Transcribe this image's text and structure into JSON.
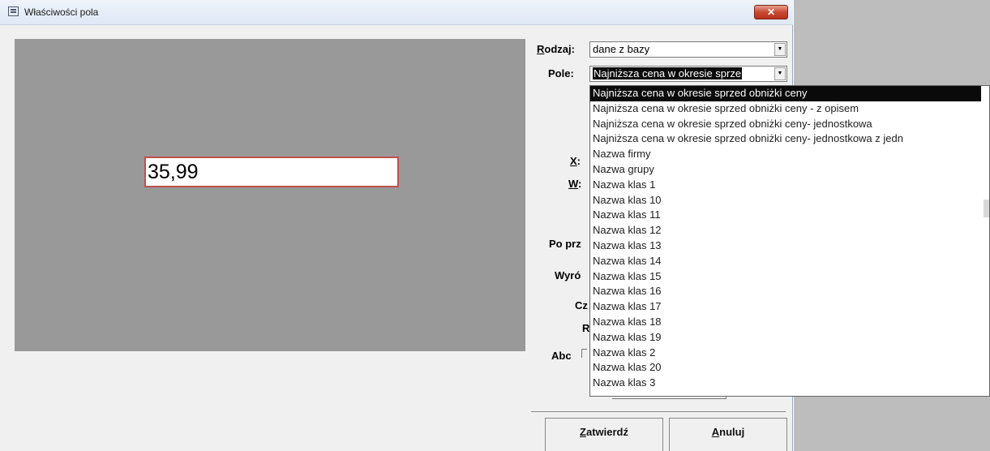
{
  "window": {
    "title": "Właściwości pola",
    "close_symbol": "✕"
  },
  "preview": {
    "value": "35,99"
  },
  "form": {
    "rodzaj": {
      "label_first": "R",
      "label_rest": "odzaj:",
      "value": "dane z bazy"
    },
    "pole": {
      "label": "Pole:",
      "value": "Najniższa cena w okresie sprze"
    },
    "x_label": {
      "first": "X",
      "rest": ":"
    },
    "w_label": {
      "first": "W",
      "rest": ":"
    },
    "partial_labels": [
      "Po prz",
      "Wyró",
      "Cz",
      "R",
      "Abc"
    ]
  },
  "dropdown": {
    "items": [
      "Najniższa cena w okresie sprzed obniżki ceny",
      "Najniższa cena w okresie sprzed obniżki ceny - z opisem",
      "Najniższa cena w okresie sprzed obniżki ceny- jednostkowa",
      "Najniższa cena w okresie sprzed obniżki ceny- jednostkowa z jedn",
      "Nazwa firmy",
      "Nazwa grupy",
      "Nazwa klas 1",
      "Nazwa klas 10",
      "Nazwa klas 11",
      "Nazwa klas 12",
      "Nazwa klas 13",
      "Nazwa klas 14",
      "Nazwa klas 15",
      "Nazwa klas 16",
      "Nazwa klas 17",
      "Nazwa klas 18",
      "Nazwa klas 19",
      "Nazwa klas 2",
      "Nazwa klas 20",
      "Nazwa klas 3"
    ],
    "selected_index": 0
  },
  "buttons": {
    "confirm": {
      "first": "Z",
      "rest": "atwierdź"
    },
    "cancel": {
      "first": "A",
      "rest": "nuluj"
    }
  },
  "colors": {
    "preview_bg": "#999999",
    "field_border": "#c0504d",
    "close_red": "#c84a32"
  }
}
